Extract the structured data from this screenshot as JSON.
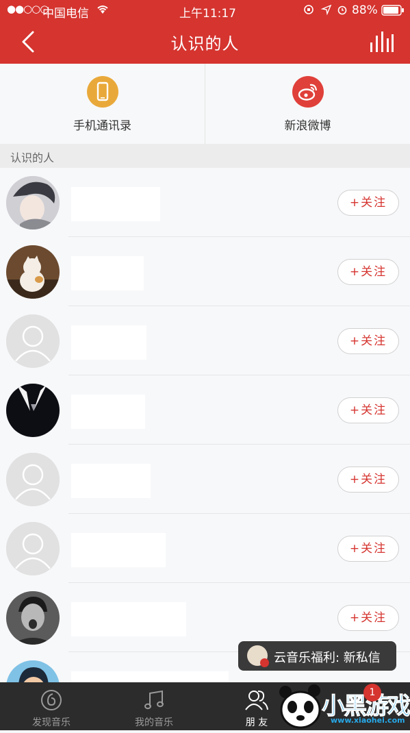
{
  "status_bar": {
    "signal": "●●○○○",
    "carrier": "中国电信",
    "time": "上午11:17",
    "battery": "88%"
  },
  "nav": {
    "title": "认识的人"
  },
  "sources": [
    {
      "label": "手机通讯录",
      "icon": "phone-icon",
      "color": "#e9a93a"
    },
    {
      "label": "新浪微博",
      "icon": "weibo-icon",
      "color": "#e0403a"
    }
  ],
  "section": {
    "title": "认识的人"
  },
  "people": [
    {
      "follow_label": "+关注",
      "avatar": "anime-avatar"
    },
    {
      "follow_label": "+关注",
      "avatar": "cat-avatar"
    },
    {
      "follow_label": "+关注",
      "avatar": "default-avatar"
    },
    {
      "follow_label": "+关注",
      "avatar": "dark-avatar"
    },
    {
      "follow_label": "+关注",
      "avatar": "default-avatar"
    },
    {
      "follow_label": "+关注",
      "avatar": "default-avatar"
    },
    {
      "follow_label": "+关注",
      "avatar": "photo-avatar"
    },
    {
      "follow_label": "",
      "avatar": "cartoon-avatar"
    }
  ],
  "toast": {
    "text": "云音乐福利: 新私信"
  },
  "tabs": [
    {
      "label": "发现音乐",
      "icon": "netease-icon",
      "active": false
    },
    {
      "label": "我的音乐",
      "icon": "music-note-icon",
      "active": false
    },
    {
      "label": "朋 友",
      "icon": "friends-icon",
      "active": true
    },
    {
      "label": "",
      "icon": "account-icon",
      "active": false
    }
  ],
  "badge": {
    "count": "1"
  },
  "watermark": {
    "text": "小黑游戏",
    "url": "www.xiaohei.com"
  },
  "colors": {
    "brand": "#d5342f",
    "tabbar": "#2c2c2c"
  }
}
